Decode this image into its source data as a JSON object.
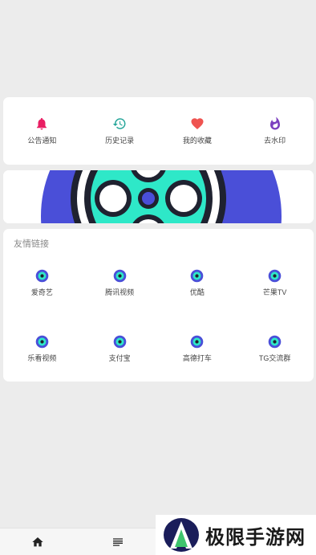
{
  "quick_actions": [
    {
      "label": "公告通知",
      "icon": "bell-icon",
      "color": "#e91e63"
    },
    {
      "label": "历史记录",
      "icon": "history-icon",
      "color": "#26a69a"
    },
    {
      "label": "我的收藏",
      "icon": "heart-icon",
      "color": "#ef5350"
    },
    {
      "label": "去水印",
      "icon": "flame-icon",
      "color": "#7b3fbf"
    }
  ],
  "friend_links": {
    "title": "友情链接",
    "items": [
      {
        "label": "爱奇艺"
      },
      {
        "label": "腾讯视频"
      },
      {
        "label": "优酷"
      },
      {
        "label": "芒果TV"
      },
      {
        "label": "乐看视频"
      },
      {
        "label": "支付宝"
      },
      {
        "label": "高德打车"
      },
      {
        "label": "TG交流群"
      }
    ]
  },
  "banner": {
    "colors": {
      "blue": "#4a4fd8",
      "teal": "#2ee8c8",
      "dark": "#1f2230"
    }
  },
  "tabbar": {
    "items": [
      {
        "icon": "home-icon"
      },
      {
        "icon": "list-icon"
      }
    ]
  },
  "watermark": {
    "text": "极限手游网"
  }
}
